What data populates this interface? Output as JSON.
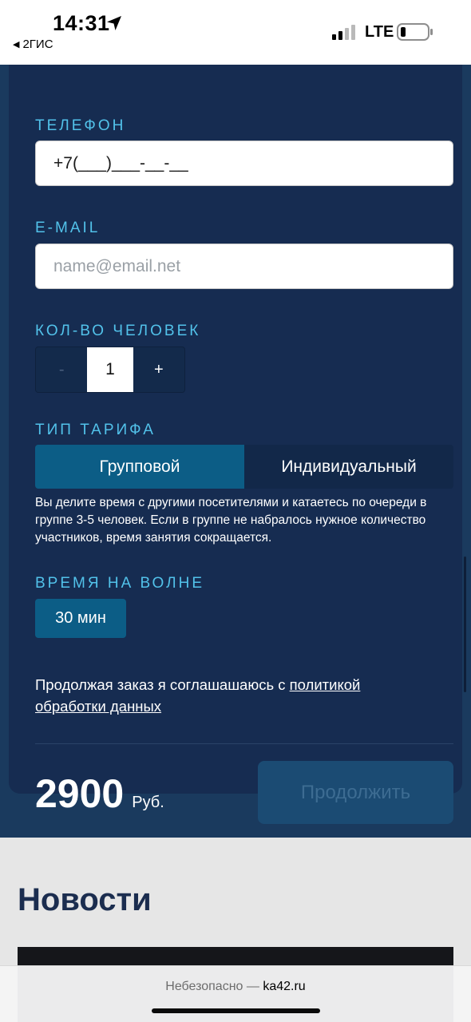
{
  "status_bar": {
    "time": "14:31",
    "back_app": "2ГИС",
    "network": "LTE"
  },
  "form": {
    "phone_label": "ТЕЛЕФОН",
    "phone_value": "+7(___)___-__-__",
    "email_label": "E-MAIL",
    "email_placeholder": "name@email.net",
    "count_label": "КОЛ-ВО ЧЕЛОВЕК",
    "count_minus": "-",
    "count_value": "1",
    "count_plus": "+",
    "tariff_label": "ТИП ТАРИФА",
    "tariff_options": [
      "Групповой",
      "Индивидуальный"
    ],
    "tariff_selected": "Групповой",
    "tariff_description": "Вы делите время с другими посетителями и катаетесь по очереди в группе 3-5 человек. Если в группе не набралось нужное количество участников, время занятия сокращается.",
    "time_label": "ВРЕМЯ НА ВОЛНЕ",
    "time_value": "30 мин",
    "consent_text": "Продолжая заказ я соглашашаюсь с ",
    "consent_link": "политикой обработки данных",
    "price_value": "2900",
    "price_currency": "Руб.",
    "continue_label": "Продолжить"
  },
  "news": {
    "title": "Новости"
  },
  "browser": {
    "security_warning": "Небезопасно",
    "separator": " — ",
    "domain": "ka42.ru"
  },
  "colors": {
    "card_bg": "#162c51",
    "label_accent": "#52c2ea",
    "active_accent": "#0c5d86",
    "button_disabled": "#1b4b73"
  }
}
